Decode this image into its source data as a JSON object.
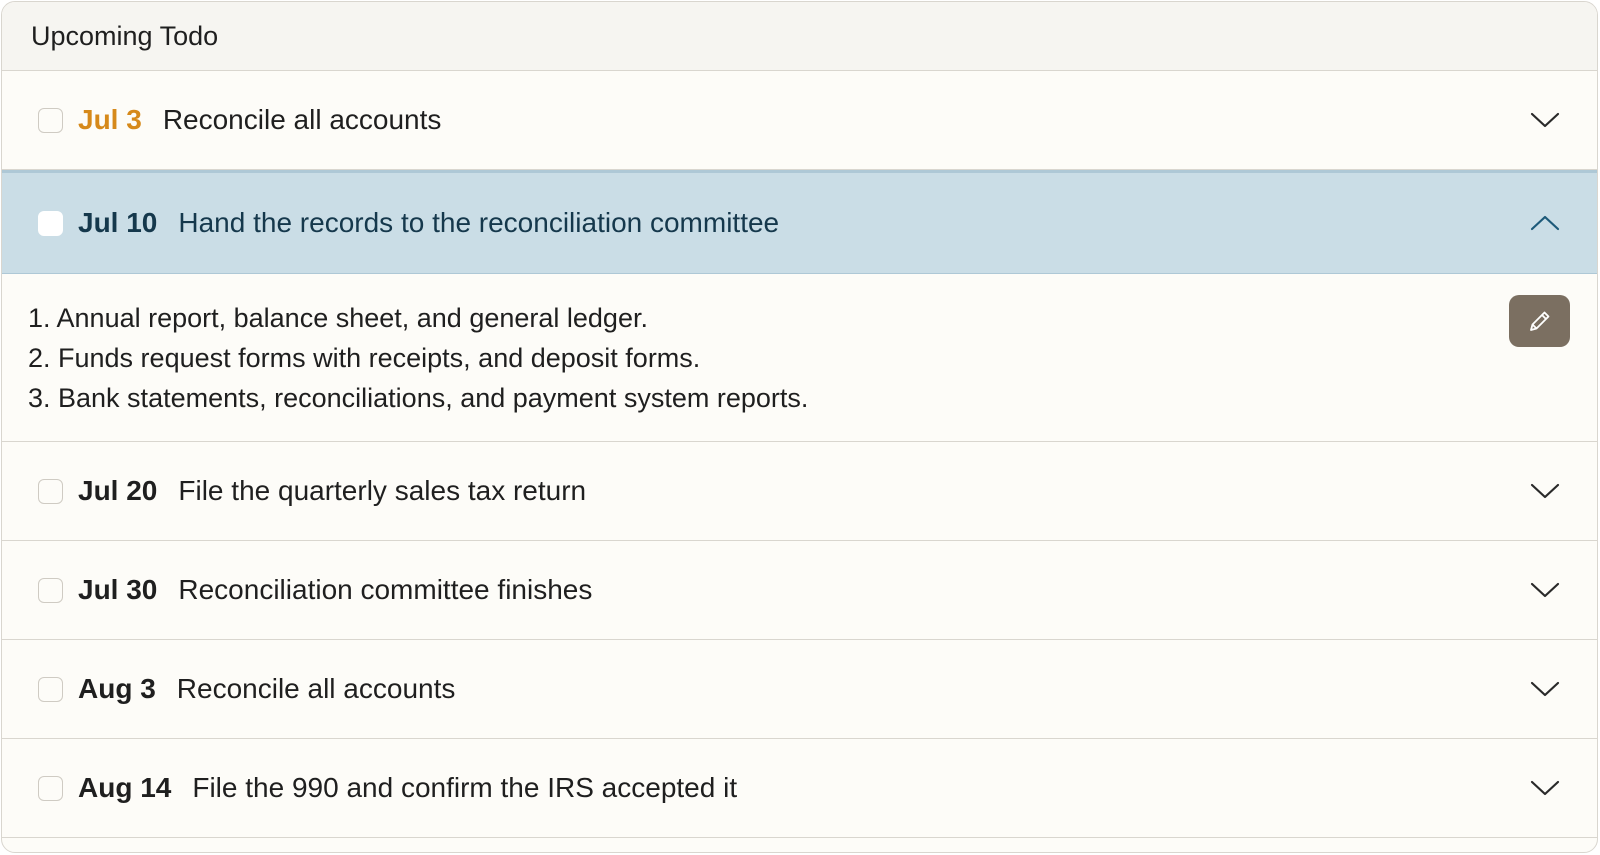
{
  "header": {
    "title": "Upcoming Todo"
  },
  "todos": [
    {
      "date": "Jul 3",
      "task": "Reconcile all accounts"
    },
    {
      "date": "Jul 10",
      "task": "Hand the records to the reconciliation committee",
      "details": [
        "1. Annual report, balance sheet, and general ledger.",
        "2. Funds request forms with receipts, and deposit forms.",
        "3. Bank statements, reconciliations, and payment system reports."
      ]
    },
    {
      "date": "Jul 20",
      "task": "File the quarterly sales tax return"
    },
    {
      "date": "Jul 30",
      "task": "Reconciliation committee finishes"
    },
    {
      "date": "Aug 3",
      "task": "Reconcile all accounts"
    },
    {
      "date": "Aug 14",
      "task": "File the 990 and confirm the IRS accepted it"
    }
  ],
  "colors": {
    "accent_soon": "#d6891a",
    "expanded_row_bg": "#cadde6",
    "expanded_text": "#15384c",
    "edit_button_bg": "#7b6f61"
  },
  "icons": {
    "collapsed": "chevron-down-icon",
    "expanded": "chevron-up-icon",
    "edit": "pencil-icon"
  }
}
